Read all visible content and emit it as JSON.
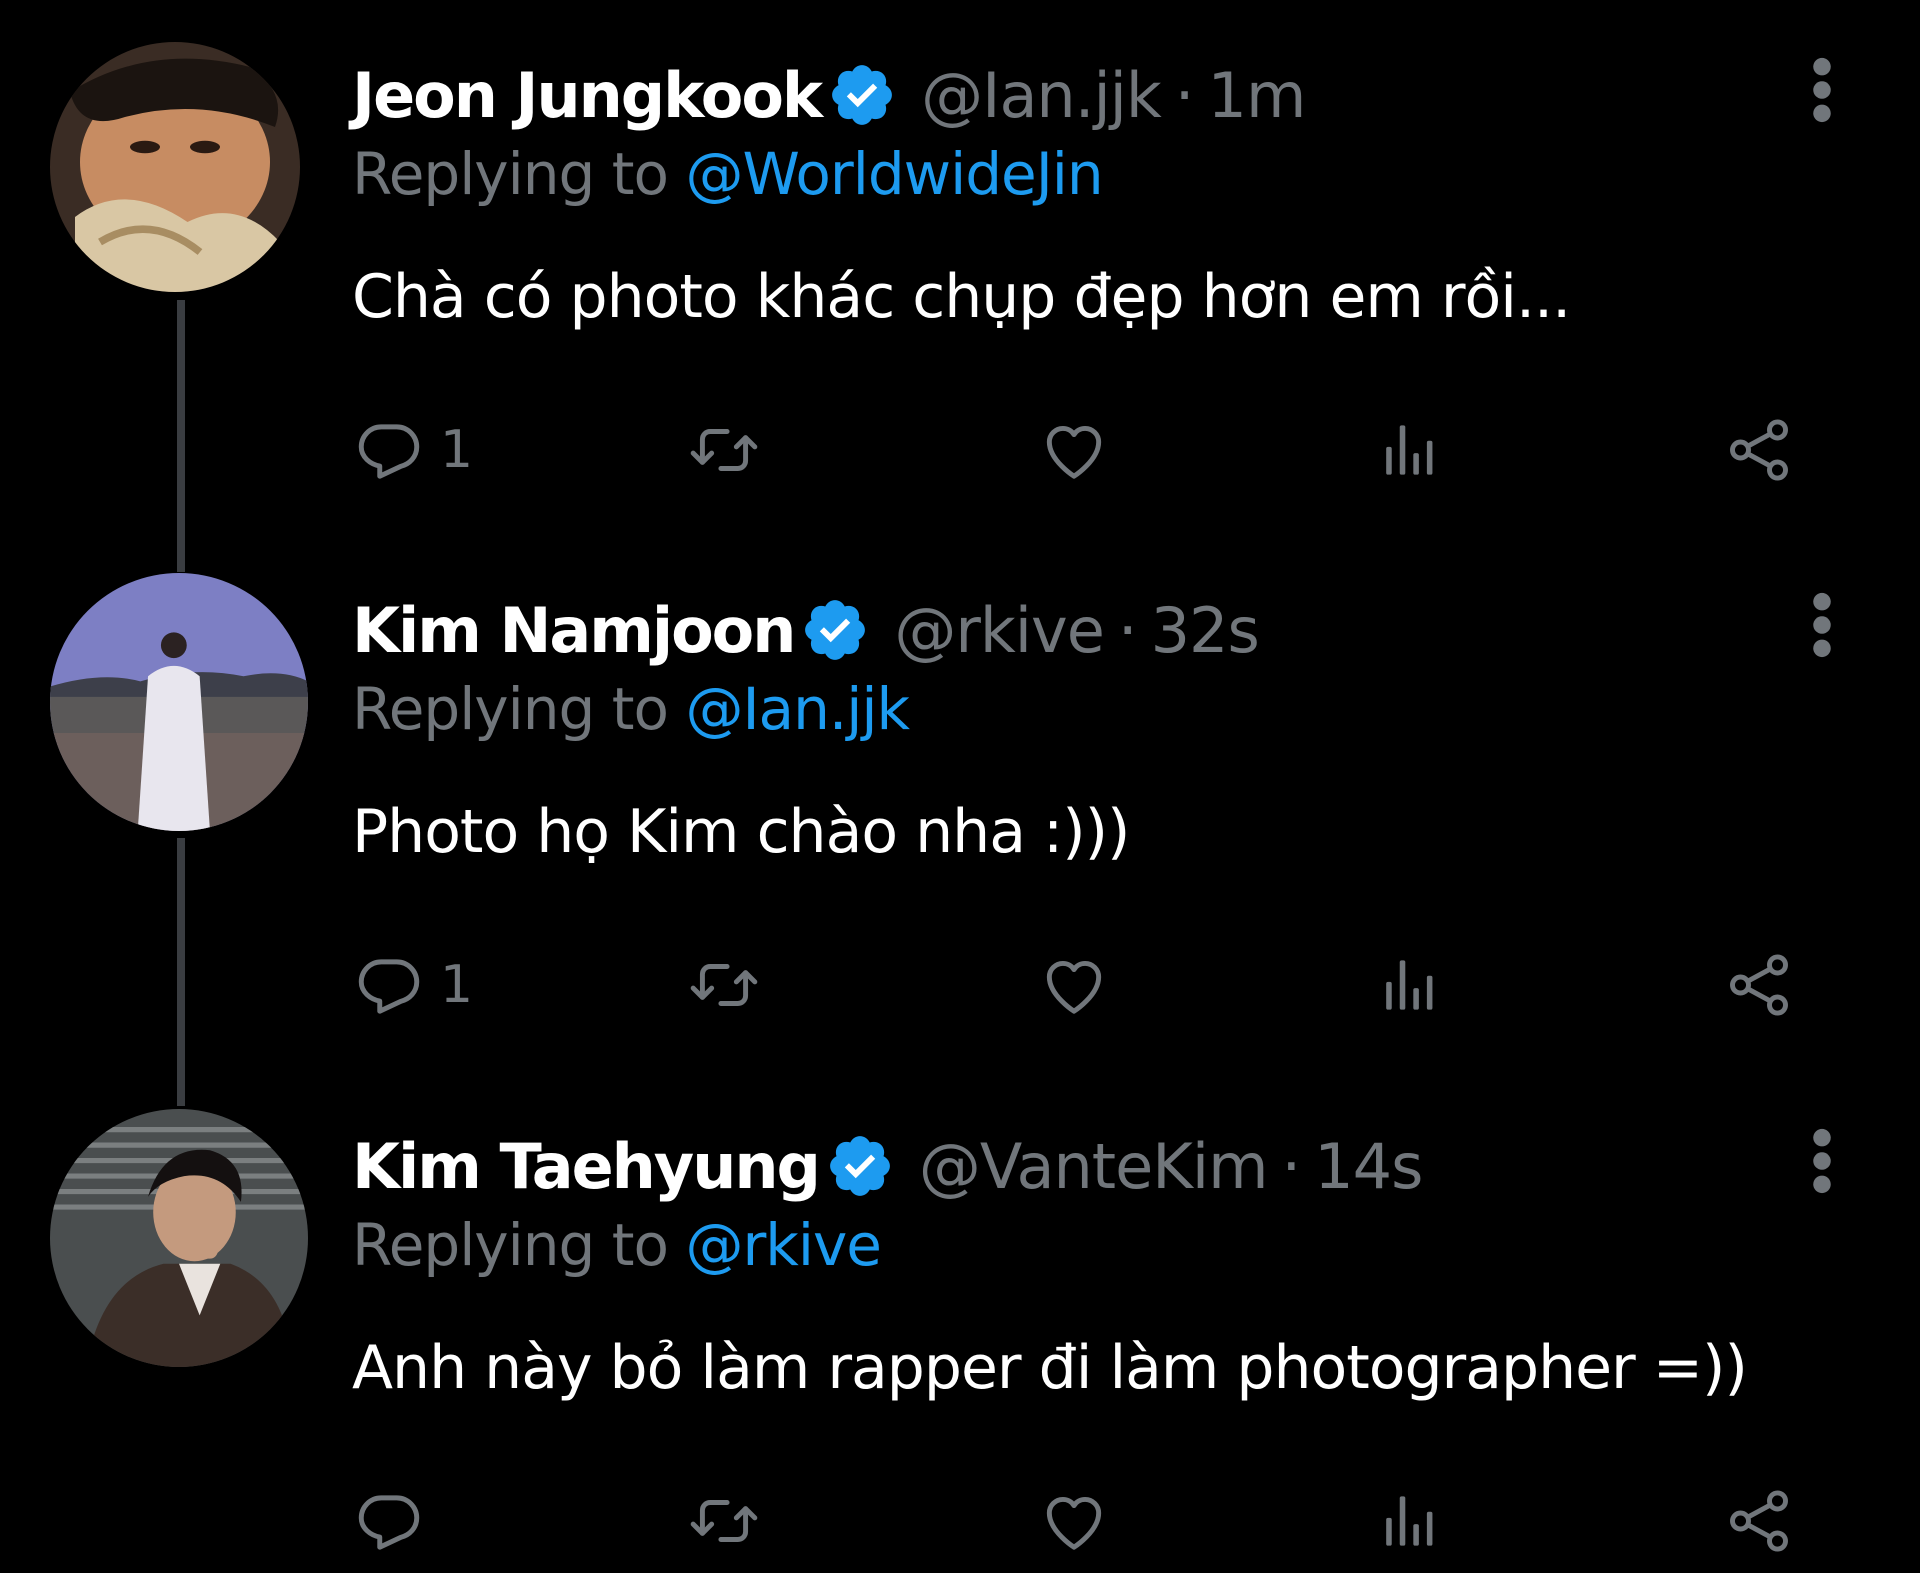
{
  "colors": {
    "background": "#000000",
    "primary_text": "#ffffff",
    "secondary_text": "#71767b",
    "mention": "#1d9bf0",
    "verified_badge": "#1d9bf0",
    "thread_line": "#3a3d41"
  },
  "tweets": [
    {
      "name": "Jeon Jungkook",
      "handle": "@Ian.jjk",
      "separator": "·",
      "time": "1m",
      "reply_prefix": "Replying to",
      "reply_to": "@WorldwideJin",
      "text": "Chà có photo khác chụp đẹp hơn em rồi...",
      "reply_count": "1",
      "icons": [
        "avatar",
        "verified-badge-icon",
        "more-options-icon",
        "reply-icon",
        "retweet-icon",
        "like-icon",
        "analytics-icon",
        "share-icon"
      ]
    },
    {
      "name": "Kim Namjoon",
      "handle": "@rkive",
      "separator": "·",
      "time": "32s",
      "reply_prefix": "Replying to",
      "reply_to": "@Ian.jjk",
      "text": "Photo họ Kim chào nha :)))",
      "reply_count": "1",
      "icons": [
        "avatar",
        "verified-badge-icon",
        "more-options-icon",
        "reply-icon",
        "retweet-icon",
        "like-icon",
        "analytics-icon",
        "share-icon"
      ]
    },
    {
      "name": "Kim Taehyung",
      "handle": "@VanteKim",
      "separator": "·",
      "time": "14s",
      "reply_prefix": "Replying to",
      "reply_to": "@rkive",
      "text": "Anh này bỏ làm rapper đi làm photographer =))",
      "reply_count": "",
      "icons": [
        "avatar",
        "verified-badge-icon",
        "more-options-icon",
        "reply-icon",
        "retweet-icon",
        "like-icon",
        "analytics-icon",
        "share-icon"
      ]
    }
  ]
}
